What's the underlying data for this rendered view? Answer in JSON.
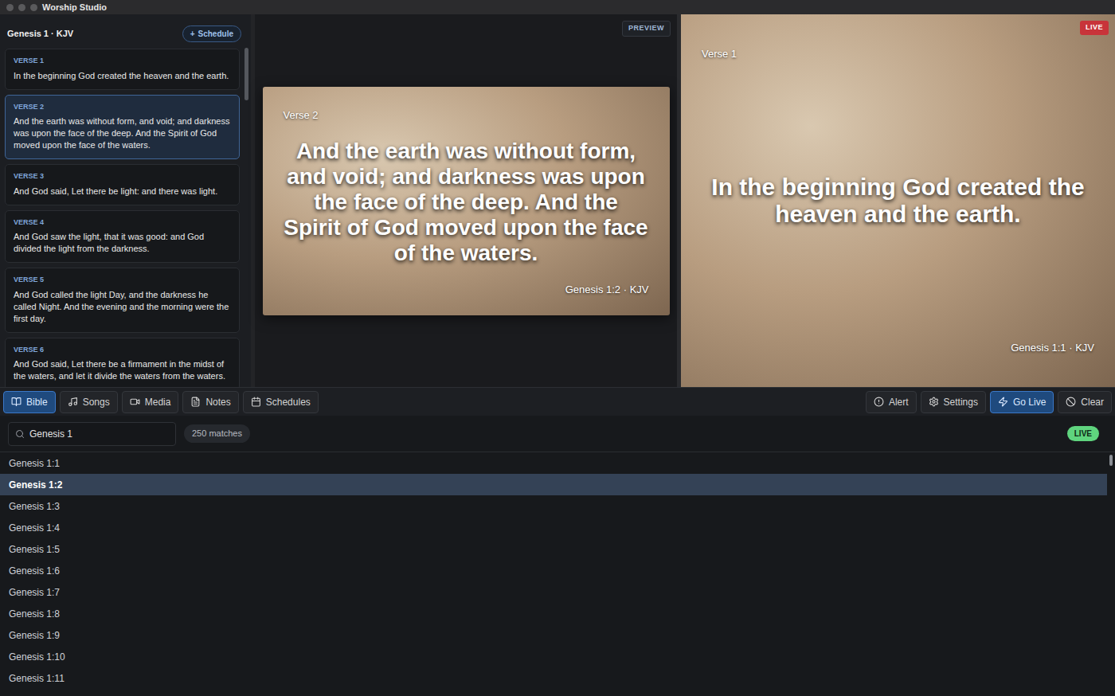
{
  "window": {
    "title": "Worship Studio"
  },
  "verse_panel": {
    "title": "Genesis 1 · KJV",
    "schedule_button": {
      "icon": "+",
      "label": "Schedule"
    },
    "verses": [
      {
        "label": "VERSE 1",
        "text": "In the beginning God created the heaven and the earth.",
        "selected": false
      },
      {
        "label": "VERSE 2",
        "text": "And the earth was without form, and void; and darkness was upon the face of the deep. And the Spirit of God moved upon the face of the waters.",
        "selected": true
      },
      {
        "label": "VERSE 3",
        "text": "And God said, Let there be light: and there was light.",
        "selected": false
      },
      {
        "label": "VERSE 4",
        "text": "And God saw the light, that it was good: and God divided the light from the darkness.",
        "selected": false
      },
      {
        "label": "VERSE 5",
        "text": "And God called the light Day, and the darkness he called Night. And the evening and the morning were the first day.",
        "selected": false
      },
      {
        "label": "VERSE 6",
        "text": "And God said, Let there be a firmament in the midst of the waters, and let it divide the waters from the waters.",
        "selected": false
      }
    ]
  },
  "preview": {
    "badge": "PREVIEW",
    "slide": {
      "label": "Verse 2",
      "text": "And the earth was without form, and void; and darkness was upon the face of the deep. And the Spirit of God moved upon the face of the waters.",
      "reference": "Genesis 1:2 · KJV"
    }
  },
  "live": {
    "badge": "LIVE",
    "slide": {
      "label": "Verse 1",
      "text": "In the beginning God created the heaven and the earth.",
      "reference": "Genesis 1:1 · KJV"
    }
  },
  "toolbar": {
    "tabs": [
      {
        "label": "Bible",
        "selected": true
      },
      {
        "label": "Songs",
        "selected": false
      },
      {
        "label": "Media",
        "selected": false
      },
      {
        "label": "Notes",
        "selected": false
      },
      {
        "label": "Schedules",
        "selected": false
      }
    ],
    "actions": [
      {
        "label": "Alert",
        "primary": false
      },
      {
        "label": "Settings",
        "primary": false
      },
      {
        "label": "Go Live",
        "primary": true
      },
      {
        "label": "Clear",
        "primary": false
      }
    ]
  },
  "search": {
    "value": "Genesis 1",
    "count": "250 matches",
    "status": "LIVE"
  },
  "results": [
    {
      "label": "Genesis 1:1",
      "selected": false
    },
    {
      "label": "Genesis 1:2",
      "selected": true
    },
    {
      "label": "Genesis 1:3",
      "selected": false
    },
    {
      "label": "Genesis 1:4",
      "selected": false
    },
    {
      "label": "Genesis 1:5",
      "selected": false
    },
    {
      "label": "Genesis 1:6",
      "selected": false
    },
    {
      "label": "Genesis 1:7",
      "selected": false
    },
    {
      "label": "Genesis 1:8",
      "selected": false
    },
    {
      "label": "Genesis 1:9",
      "selected": false
    },
    {
      "label": "Genesis 1:10",
      "selected": false
    },
    {
      "label": "Genesis 1:11",
      "selected": false
    }
  ]
}
